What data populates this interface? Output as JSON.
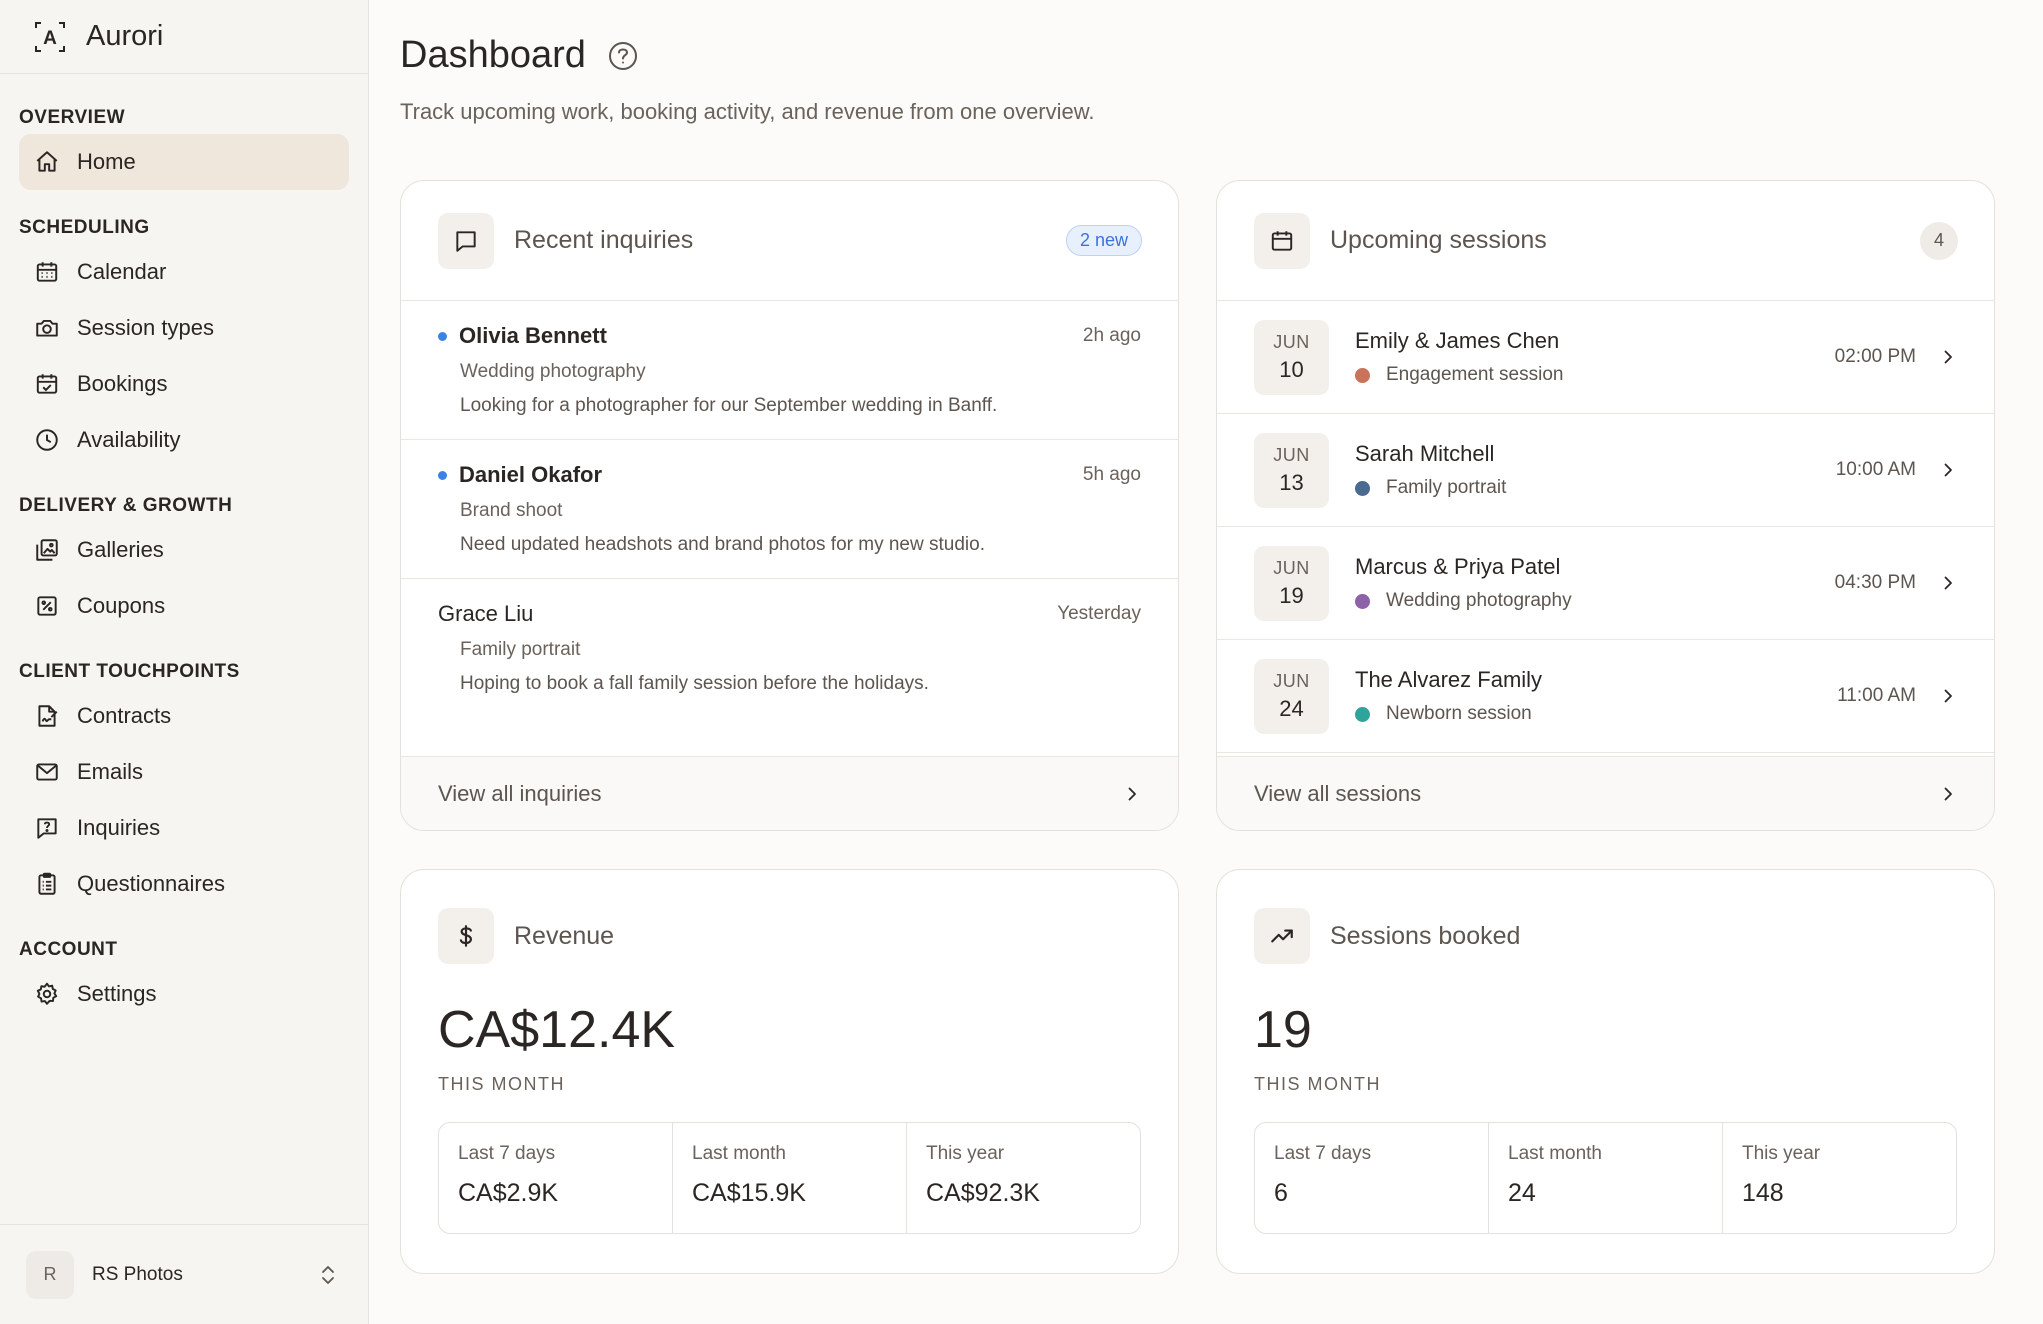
{
  "brand": {
    "logo_letter": "A",
    "name": "Aurori"
  },
  "sidebar": {
    "sections": [
      {
        "title": "OVERVIEW",
        "items": [
          {
            "label": "Home",
            "icon": "home-icon",
            "active": true
          }
        ]
      },
      {
        "title": "SCHEDULING",
        "items": [
          {
            "label": "Calendar",
            "icon": "calendar-icon"
          },
          {
            "label": "Session types",
            "icon": "camera-icon"
          },
          {
            "label": "Bookings",
            "icon": "calendar-check-icon"
          },
          {
            "label": "Availability",
            "icon": "clock-icon"
          }
        ]
      },
      {
        "title": "DELIVERY & GROWTH",
        "items": [
          {
            "label": "Galleries",
            "icon": "gallery-icon"
          },
          {
            "label": "Coupons",
            "icon": "coupon-icon"
          }
        ]
      },
      {
        "title": "CLIENT TOUCHPOINTS",
        "items": [
          {
            "label": "Contracts",
            "icon": "contract-icon"
          },
          {
            "label": "Emails",
            "icon": "mail-icon"
          },
          {
            "label": "Inquiries",
            "icon": "inquiry-icon"
          },
          {
            "label": "Questionnaires",
            "icon": "clipboard-icon"
          }
        ]
      },
      {
        "title": "ACCOUNT",
        "items": [
          {
            "label": "Settings",
            "icon": "gear-icon"
          }
        ]
      }
    ],
    "account": {
      "initial": "R",
      "name": "RS Photos"
    }
  },
  "header": {
    "title": "Dashboard",
    "subtitle": "Track upcoming work, booking activity, and revenue from one overview."
  },
  "inquiries": {
    "title": "Recent inquiries",
    "badge": "2 new",
    "items": [
      {
        "name": "Olivia Bennett",
        "time": "2h ago",
        "type": "Wedding photography",
        "message": "Looking for a photographer for our September wedding in Banff.",
        "unread": true
      },
      {
        "name": "Daniel Okafor",
        "time": "5h ago",
        "type": "Brand shoot",
        "message": "Need updated headshots and brand photos for my new studio.",
        "unread": true
      },
      {
        "name": "Grace Liu",
        "time": "Yesterday",
        "type": "Family portrait",
        "message": "Hoping to book a fall family session before the holidays.",
        "unread": false
      }
    ],
    "footer": "View all inquiries"
  },
  "sessions": {
    "title": "Upcoming sessions",
    "count": "4",
    "items": [
      {
        "month": "JUN",
        "day": "10",
        "name": "Emily & James Chen",
        "type": "Engagement session",
        "color": "#c8735a",
        "time": "02:00 PM"
      },
      {
        "month": "JUN",
        "day": "13",
        "name": "Sarah Mitchell",
        "type": "Family portrait",
        "color": "#4a6a8f",
        "time": "10:00 AM"
      },
      {
        "month": "JUN",
        "day": "19",
        "name": "Marcus & Priya Patel",
        "type": "Wedding photography",
        "color": "#8e62a8",
        "time": "04:30 PM"
      },
      {
        "month": "JUN",
        "day": "24",
        "name": "The Alvarez Family",
        "type": "Newborn session",
        "color": "#2fa49a",
        "time": "11:00 AM"
      }
    ],
    "footer": "View all sessions"
  },
  "revenue": {
    "title": "Revenue",
    "value": "CA$12.4K",
    "caption": "THIS MONTH",
    "stats": [
      {
        "label": "Last 7 days",
        "value": "CA$2.9K"
      },
      {
        "label": "Last month",
        "value": "CA$15.9K"
      },
      {
        "label": "This year",
        "value": "CA$92.3K"
      }
    ]
  },
  "booked": {
    "title": "Sessions booked",
    "value": "19",
    "caption": "THIS MONTH",
    "stats": [
      {
        "label": "Last 7 days",
        "value": "6"
      },
      {
        "label": "Last month",
        "value": "24"
      },
      {
        "label": "This year",
        "value": "148"
      }
    ]
  },
  "colors": {
    "accent_blue": "#3b82e6",
    "active_nav_bg": "#efe6dc",
    "sidebar_bg": "#f7f5f2"
  }
}
